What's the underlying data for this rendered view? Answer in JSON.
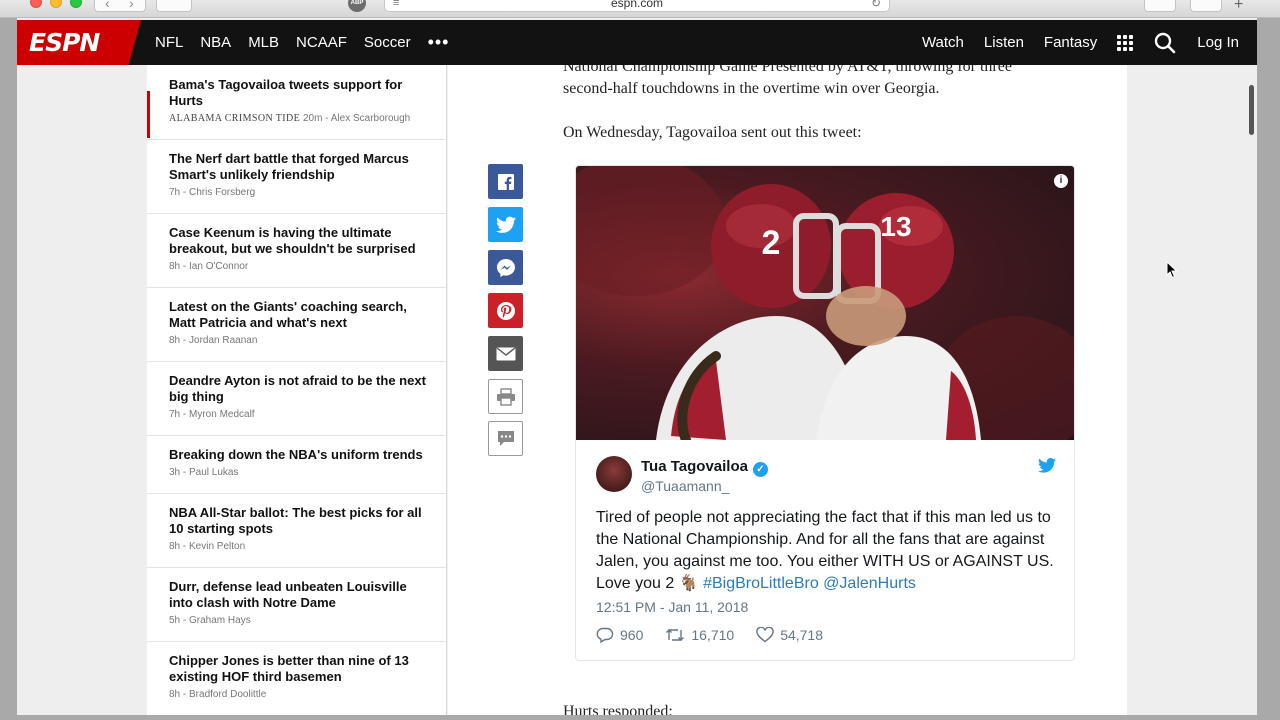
{
  "browser": {
    "url": "espn.com",
    "abp_label": "ABP"
  },
  "nav": {
    "logo": "ESPN",
    "left_items": [
      "NFL",
      "NBA",
      "MLB",
      "NCAAF",
      "Soccer"
    ],
    "more": "•••",
    "right_items": [
      "Watch",
      "Listen",
      "Fantasy"
    ],
    "login": "Log In"
  },
  "sidebar": {
    "stories": [
      {
        "title": "Bama's Tagovailoa tweets support for Hurts",
        "source": "ALABAMA CRIMSON TIDE",
        "meta": "20m - Alex Scarborough"
      },
      {
        "title": "The Nerf dart battle that forged Marcus Smart's unlikely friendship",
        "source": "",
        "meta": "7h - Chris Forsberg"
      },
      {
        "title": "Case Keenum is having the ultimate breakout, but we shouldn't be surprised",
        "source": "",
        "meta": "8h - Ian O'Connor"
      },
      {
        "title": "Latest on the Giants' coaching search, Matt Patricia and what's next",
        "source": "",
        "meta": "8h - Jordan Raanan"
      },
      {
        "title": "Deandre Ayton is not afraid to be the next big thing",
        "source": "",
        "meta": "7h - Myron Medcalf"
      },
      {
        "title": "Breaking down the NBA's uniform trends",
        "source": "",
        "meta": "3h - Paul Lukas"
      },
      {
        "title": "NBA All-Star ballot: The best picks for all 10 starting spots",
        "source": "",
        "meta": "8h - Kevin Pelton"
      },
      {
        "title": "Durr, defense lead unbeaten Louisville into clash with Notre Dame",
        "source": "",
        "meta": "5h - Graham Hays"
      },
      {
        "title": "Chipper Jones is better than nine of 13 existing HOF third basemen",
        "source": "",
        "meta": "8h - Bradford Doolittle"
      }
    ]
  },
  "article": {
    "para_partial": "National Championship Game Presented by AT&T, throwing for three",
    "para_line2": "second-half touchdowns in the overtime win over Georgia.",
    "para2": "On Wednesday, Tagovailoa sent out this tweet:",
    "para3": "Hurts responded:"
  },
  "tweet": {
    "name": "Tua Tagovailoa",
    "handle": "@Tuaamann_",
    "text_main": "Tired of people not appreciating the fact that if this man led us to the National Championship. And for all the fans that are against Jalen, you against me too. You either WITH US or AGAINST US. Love you 2 🐐",
    "text_links": "#BigBroLittleBro @JalenHurts",
    "time": "12:51 PM - Jan 11, 2018",
    "replies": "960",
    "retweets": "16,710",
    "likes": "54,718",
    "jersey_left": "2",
    "jersey_right": "13"
  },
  "colors": {
    "espn_red": "#cc0000",
    "twitter_blue": "#1da1f2",
    "facebook": "#3b5998",
    "pinterest": "#cb2027"
  }
}
